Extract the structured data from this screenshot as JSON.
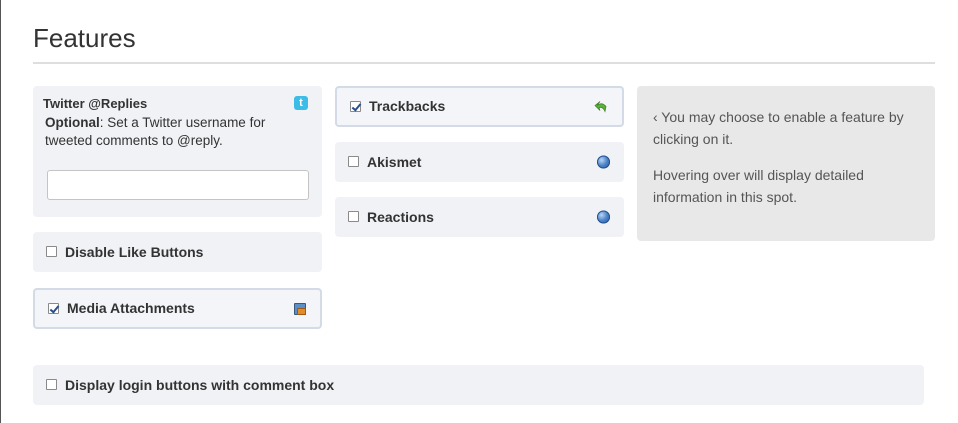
{
  "page": {
    "title": "Features"
  },
  "twitter": {
    "title": "Twitter @Replies",
    "desc_bold": "Optional",
    "desc_rest": ": Set a Twitter username for tweeted comments to @reply.",
    "input_value": "",
    "icon": "twitter-icon"
  },
  "features": {
    "disable_like": {
      "label": "Disable Like Buttons",
      "checked": false
    },
    "media_attachments": {
      "label": "Media Attachments",
      "checked": true,
      "icon": "media-icon"
    },
    "login_buttons": {
      "label": "Display login buttons with comment box",
      "checked": false
    },
    "trackbacks": {
      "label": "Trackbacks",
      "checked": true,
      "icon": "undo-icon"
    },
    "akismet": {
      "label": "Akismet",
      "checked": false,
      "icon": "globe-icon"
    },
    "reactions": {
      "label": "Reactions",
      "checked": false,
      "icon": "globe-icon"
    }
  },
  "info": {
    "line1": "‹ You may choose to enable a feature by clicking on it.",
    "line2": "Hovering over will display detailed information in this spot."
  },
  "colors": {
    "card_bg": "#f0f2f5",
    "info_bg": "#e8e8e8",
    "twitter_blue": "#3dbce8",
    "check": "#2a4f8a"
  }
}
